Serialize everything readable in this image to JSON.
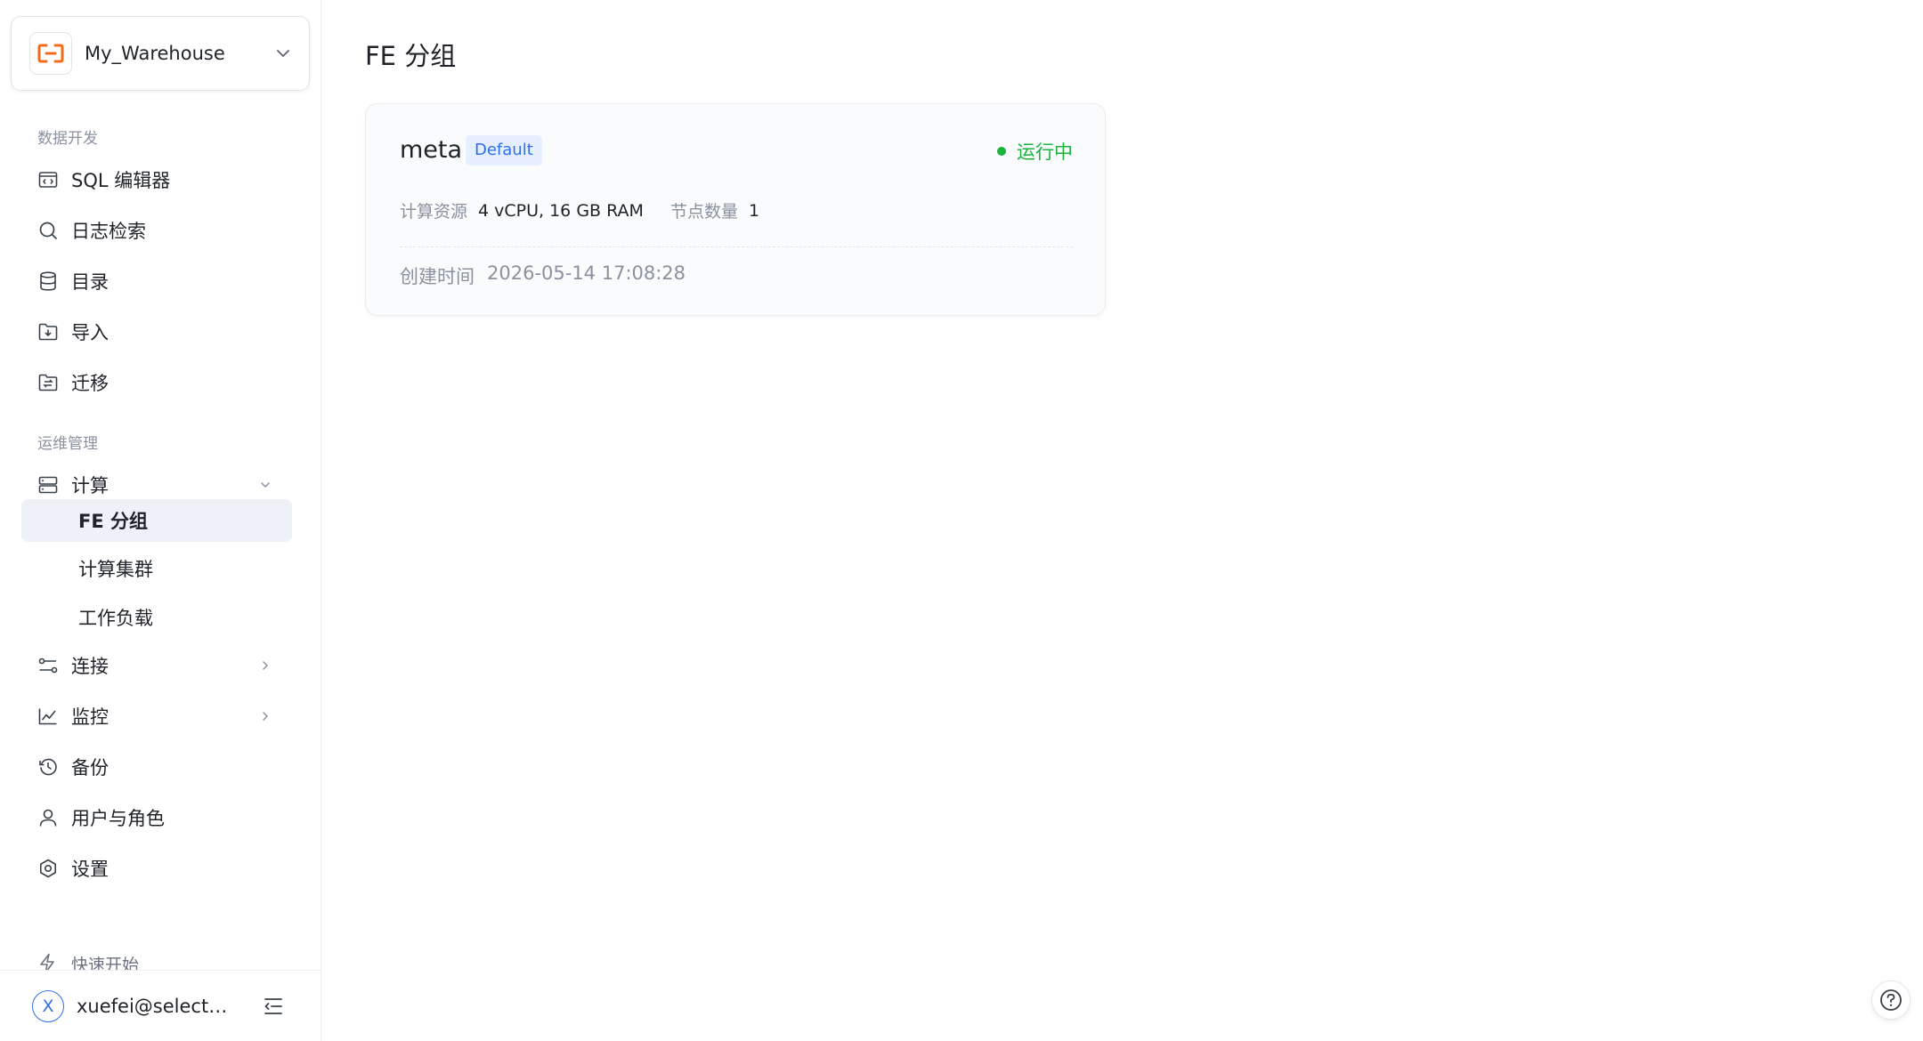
{
  "workspace": {
    "name": "My_Warehouse"
  },
  "sidebar": {
    "section_dev": "数据开发",
    "section_ops": "运维管理",
    "items": {
      "sql_editor": "SQL 编辑器",
      "log_search": "日志检索",
      "catalog": "目录",
      "import": "导入",
      "migrate": "迁移",
      "compute": "计算",
      "fe_group": "FE 分组",
      "compute_cluster": "计算集群",
      "workload": "工作负载",
      "connect": "连接",
      "monitor": "监控",
      "backup": "备份",
      "users_roles": "用户与角色",
      "settings": "设置"
    },
    "quick_start": "快速开始",
    "user": {
      "avatar_letter": "X",
      "email": "xuefei@selectd..."
    }
  },
  "main": {
    "title": "FE 分组",
    "card": {
      "name": "meta",
      "badge": "Default",
      "status": "运行中",
      "compute_label": "计算资源",
      "compute_value": "4 vCPU, 16 GB RAM",
      "nodes_label": "节点数量",
      "nodes_value": "1",
      "created_label": "创建时间",
      "created_value": "2026-05-14 17:08:28"
    }
  },
  "colors": {
    "accent": "#2f6fe8",
    "brand_orange": "#f26b1d",
    "status_running": "#19b23d",
    "active_nav_bg": "#eef1f7"
  },
  "icons": {
    "workspace_logo": "cloud-bracket-icon",
    "help": "help-circle-icon"
  }
}
